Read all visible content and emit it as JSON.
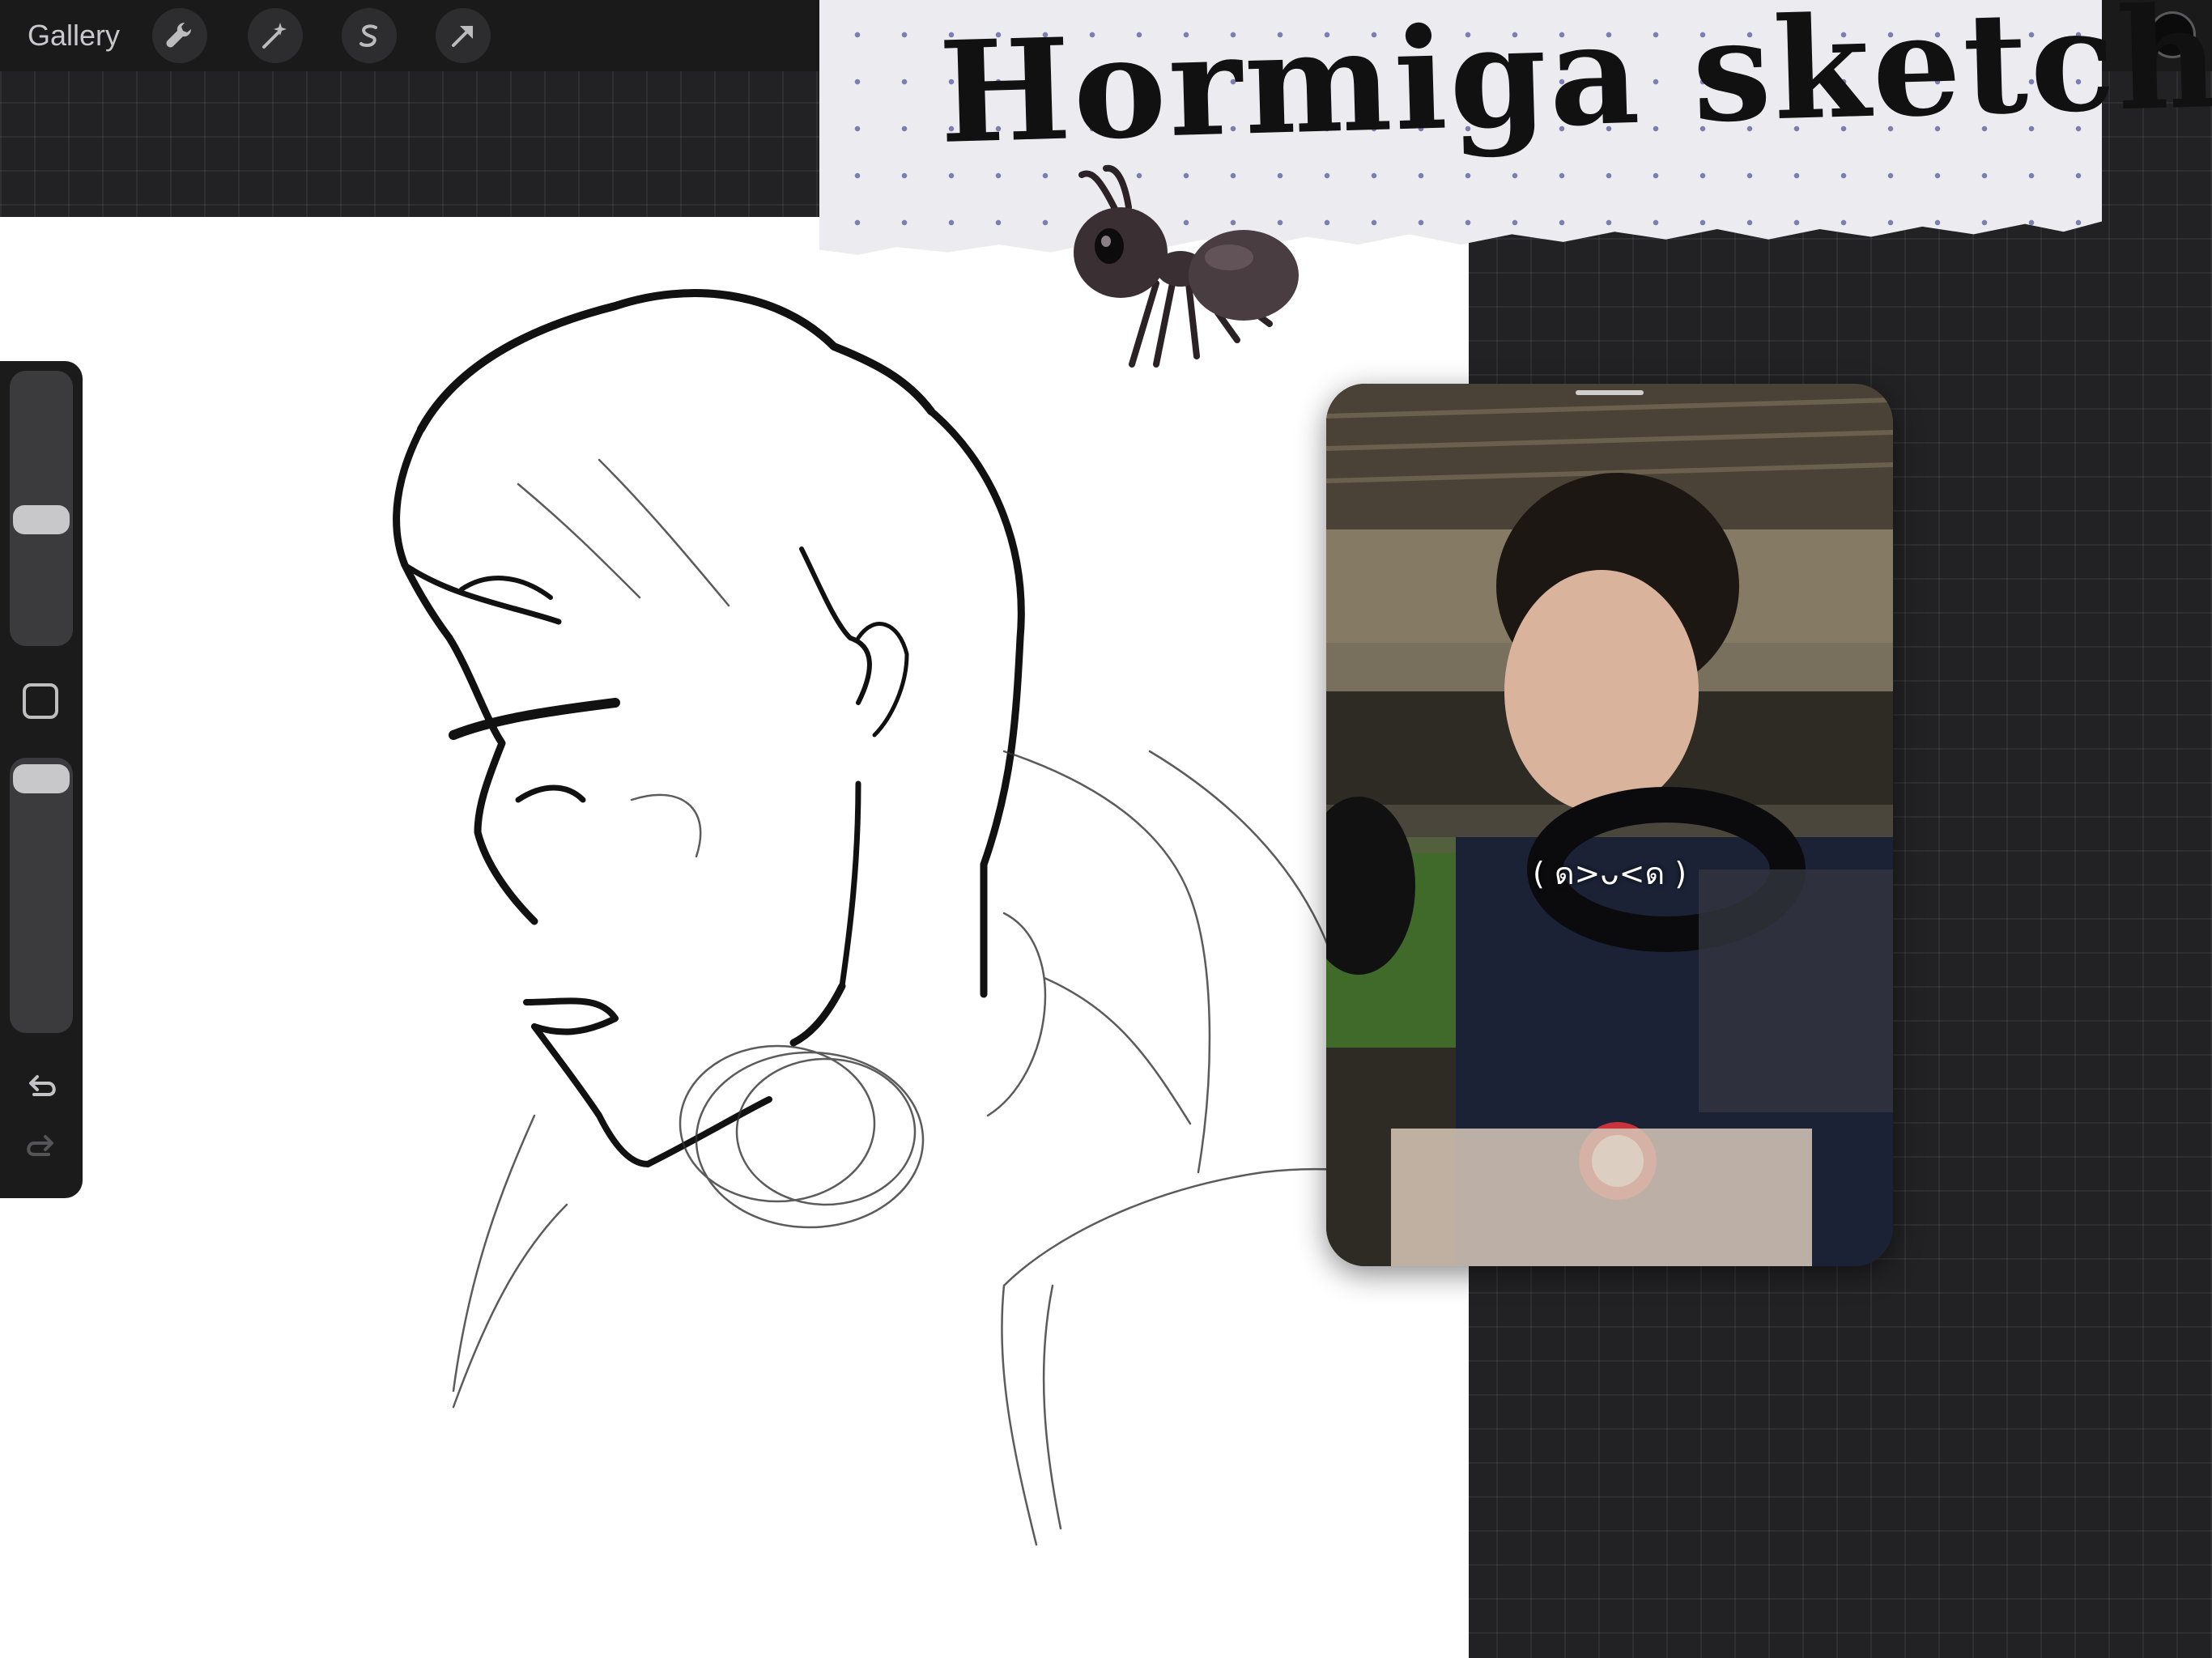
{
  "app": {
    "gallery_label": "Gallery",
    "tools": [
      {
        "name": "actions-wrench-icon"
      },
      {
        "name": "adjustments-magic-wand-icon"
      },
      {
        "name": "selection-s-icon"
      },
      {
        "name": "transform-arrow-icon"
      }
    ],
    "current_color": "#0b0b0b"
  },
  "sidebar": {
    "brush_size_level": 0.45,
    "opacity_level": 0.95,
    "icons": [
      "modifier-square-icon",
      "undo-icon",
      "redo-icon"
    ]
  },
  "overlay": {
    "title": "Hormiga sketch",
    "sticker": "ant-icon"
  },
  "reference_photo": {
    "caption": "( ด>ᴗ<ด )"
  },
  "colors": {
    "topbar": "#1a1a1b",
    "canvas": "#ffffff",
    "background": "#222224",
    "sidebar": "#1b1b1c"
  }
}
